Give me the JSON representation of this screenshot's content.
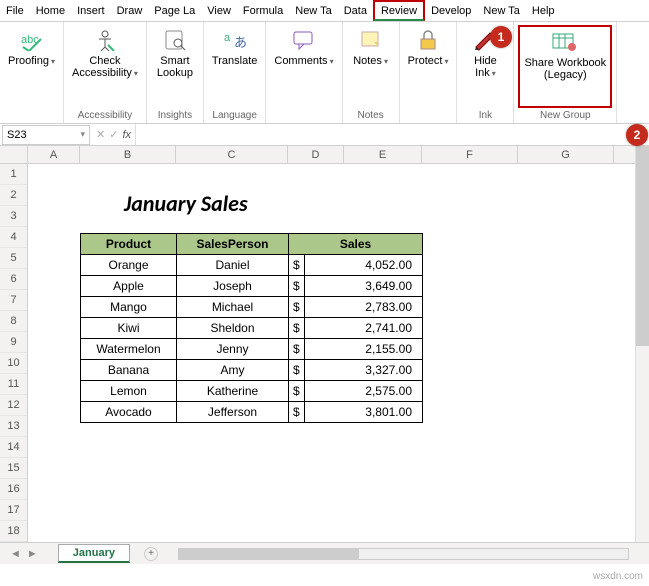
{
  "menu": [
    "File",
    "Home",
    "Insert",
    "Draw",
    "Page La",
    "View",
    "Formula",
    "New Ta",
    "Data",
    "Review",
    "Develop",
    "New Ta",
    "Help"
  ],
  "menu_active": "Review",
  "ribbon": {
    "groups": [
      {
        "label": "",
        "buttons": [
          {
            "name": "proofing",
            "label": "Proofing",
            "drop": true
          }
        ]
      },
      {
        "label": "Accessibility",
        "buttons": [
          {
            "name": "check-accessibility",
            "label": "Check\nAccessibility",
            "drop": true
          }
        ]
      },
      {
        "label": "Insights",
        "buttons": [
          {
            "name": "smart-lookup",
            "label": "Smart\nLookup"
          }
        ]
      },
      {
        "label": "Language",
        "buttons": [
          {
            "name": "translate",
            "label": "Translate"
          }
        ]
      },
      {
        "label": "",
        "buttons": [
          {
            "name": "comments",
            "label": "Comments",
            "drop": true
          }
        ]
      },
      {
        "label": "Notes",
        "buttons": [
          {
            "name": "notes",
            "label": "Notes",
            "drop": true
          }
        ]
      },
      {
        "label": "",
        "buttons": [
          {
            "name": "protect",
            "label": "Protect",
            "drop": true
          }
        ]
      },
      {
        "label": "Ink",
        "buttons": [
          {
            "name": "hide-ink",
            "label": "Hide\nInk",
            "drop": true
          }
        ]
      },
      {
        "label": "New Group",
        "buttons": [
          {
            "name": "share-workbook",
            "label": "Share Workbook\n(Legacy)"
          }
        ]
      }
    ]
  },
  "namebox": "S23",
  "fx_symbol": "fx",
  "columns": [
    "A",
    "B",
    "C",
    "D",
    "E",
    "F",
    "G"
  ],
  "row_count": 18,
  "title": "January Sales",
  "table": {
    "headers": [
      "Product",
      "SalesPerson",
      "Sales"
    ],
    "rows": [
      {
        "product": "Orange",
        "person": "Daniel",
        "currency": "$",
        "amount": "4,052.00"
      },
      {
        "product": "Apple",
        "person": "Joseph",
        "currency": "$",
        "amount": "3,649.00"
      },
      {
        "product": "Mango",
        "person": "Michael",
        "currency": "$",
        "amount": "2,783.00"
      },
      {
        "product": "Kiwi",
        "person": "Sheldon",
        "currency": "$",
        "amount": "2,741.00"
      },
      {
        "product": "Watermelon",
        "person": "Jenny",
        "currency": "$",
        "amount": "2,155.00"
      },
      {
        "product": "Banana",
        "person": "Amy",
        "currency": "$",
        "amount": "3,327.00"
      },
      {
        "product": "Lemon",
        "person": "Katherine",
        "currency": "$",
        "amount": "2,575.00"
      },
      {
        "product": "Avocado",
        "person": "Jefferson",
        "currency": "$",
        "amount": "3,801.00"
      }
    ]
  },
  "sheet_tab": "January",
  "watermark": "wsxdn.com",
  "callouts": {
    "one": "1",
    "two": "2"
  }
}
